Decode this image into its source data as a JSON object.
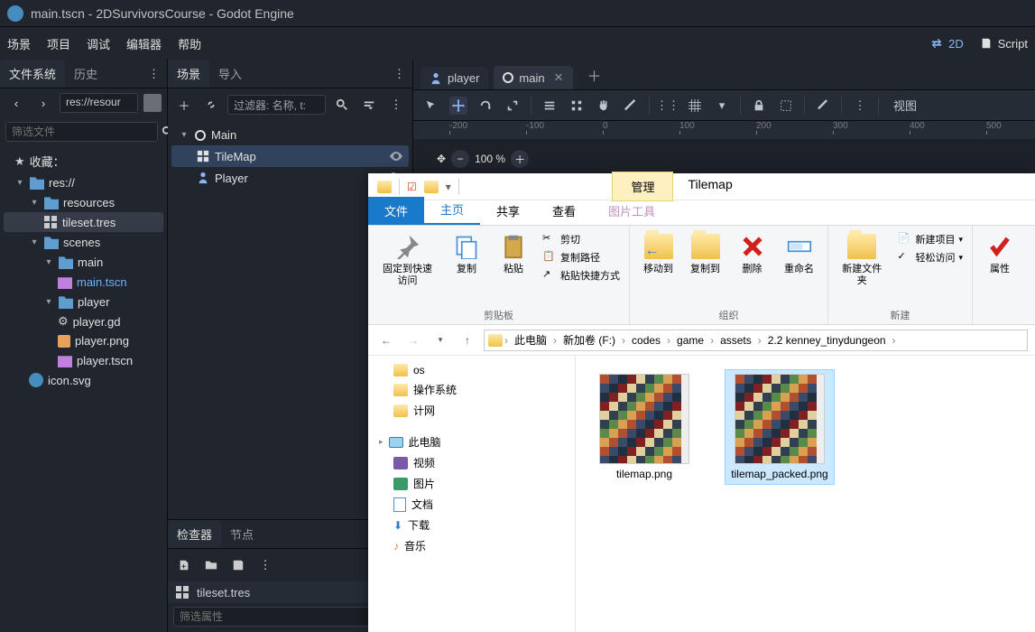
{
  "window_title": "main.tscn - 2DSurvivorsCourse - Godot Engine",
  "menu": {
    "scene": "场景",
    "project": "项目",
    "debug": "调试",
    "editor": "编辑器",
    "help": "帮助",
    "mode_2d": "2D",
    "mode_script": "Script"
  },
  "left_dock": {
    "tab_fs": "文件系统",
    "tab_history": "历史",
    "path": "res://resour",
    "filter_placeholder": "筛选文件",
    "favorites": "收藏：",
    "root": "res://",
    "folders": {
      "resources": "resources",
      "scenes": "scenes",
      "main": "main",
      "player": "player"
    },
    "files": {
      "tileset": "tileset.tres",
      "main_tscn": "main.tscn",
      "player_gd": "player.gd",
      "player_png": "player.png",
      "player_tscn": "player.tscn",
      "icon_svg": "icon.svg"
    }
  },
  "scene_dock": {
    "tab_scene": "场景",
    "tab_import": "导入",
    "filter_placeholder": "过滤器: 名称, t:",
    "nodes": {
      "root": "Main",
      "tilemap": "TileMap",
      "player": "Player"
    }
  },
  "file_tabs": {
    "player": "player",
    "main": "main"
  },
  "viewport": {
    "zoom": "100 %",
    "view_btn": "视图",
    "ruler_ticks": [
      "-200",
      "-100",
      "0",
      "100",
      "200",
      "300",
      "400",
      "500"
    ]
  },
  "inspector": {
    "tab_inspector": "检查器",
    "tab_node": "节点",
    "resource": "tileset.tres",
    "filter_placeholder": "筛选属性"
  },
  "explorer": {
    "qa_manage": "管理",
    "title": "Tilemap",
    "tabs": {
      "file": "文件",
      "home": "主页",
      "share": "共享",
      "view": "查看",
      "picture": "图片工具"
    },
    "ribbon": {
      "pin": "固定到快速访问",
      "copy": "复制",
      "paste": "粘贴",
      "cut": "剪切",
      "copypath": "复制路径",
      "paste_shortcut": "粘贴快捷方式",
      "g_clip": "剪贴板",
      "moveto": "移动到",
      "copyto": "复制到",
      "delete": "删除",
      "rename": "重命名",
      "g_org": "组织",
      "newfolder": "新建文件夹",
      "newitem": "新建项目",
      "easy": "轻松访问",
      "g_new": "新建",
      "properties": "属性"
    },
    "breadcrumb": [
      "此电脑",
      "新加卷 (F:)",
      "codes",
      "game",
      "assets",
      "2.2 kenney_tinydungeon"
    ],
    "tree": {
      "os": "os",
      "cz": "操作系统",
      "jw": "计网",
      "pc": "此电脑",
      "video": "视频",
      "pics": "图片",
      "docs": "文档",
      "dl": "下载",
      "music": "音乐"
    },
    "files": {
      "f1": "tilemap.png",
      "f2": "tilemap_packed.png"
    }
  }
}
